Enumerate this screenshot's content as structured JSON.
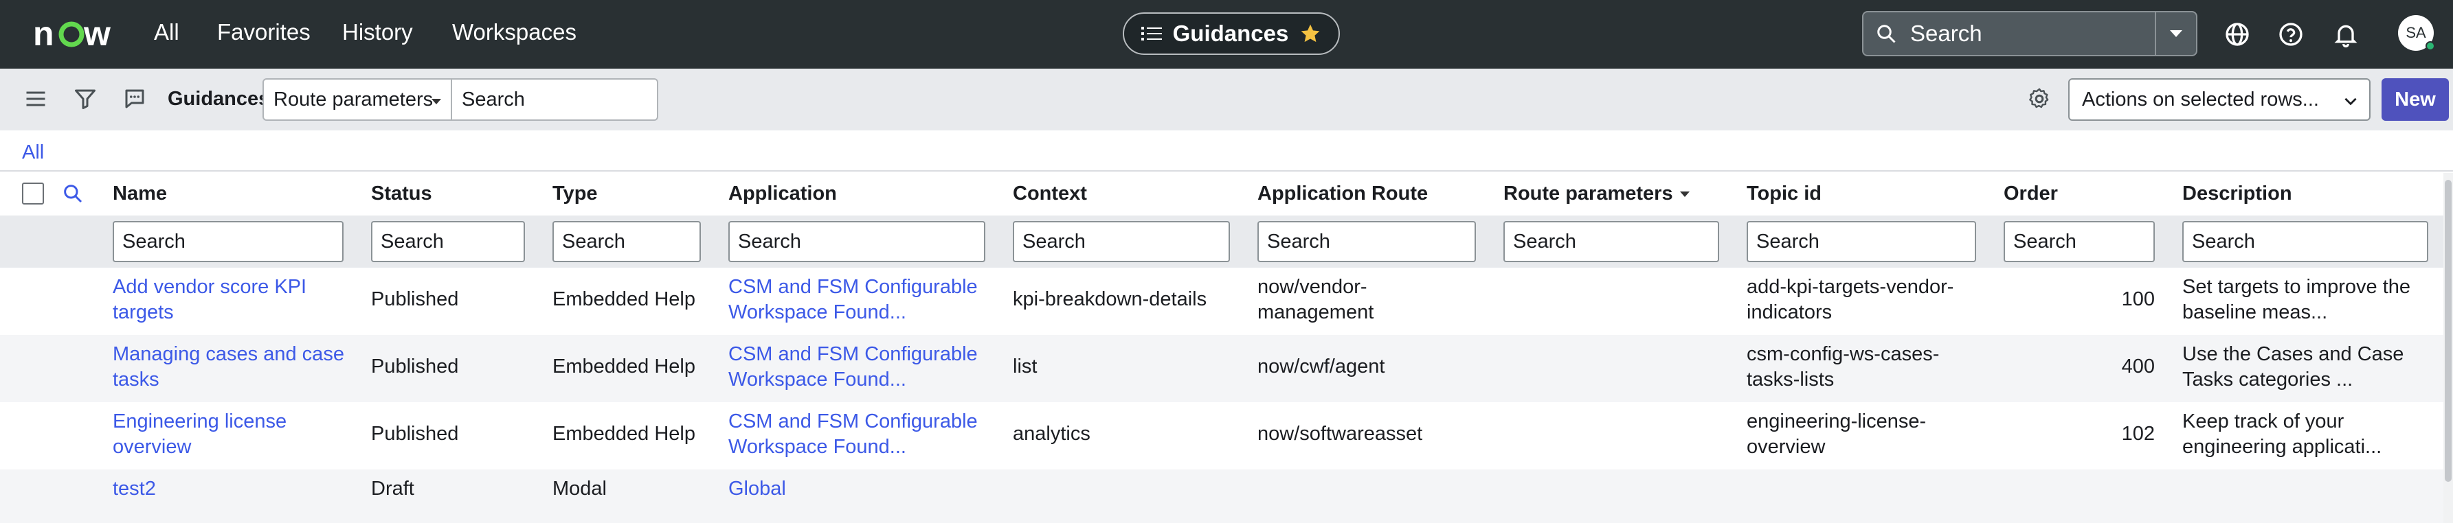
{
  "nav": {
    "logo": "now",
    "items": [
      "All",
      "Favorites",
      "History",
      "Workspaces"
    ],
    "center_title": "Guidances",
    "search_placeholder": "Search",
    "avatar_initials": "SA"
  },
  "toolbar": {
    "title": "Guidances",
    "route_select": "Route parameters",
    "search_placeholder": "Search",
    "actions_label": "Actions on selected rows...",
    "new_label": "New"
  },
  "breadcrumb": {
    "all": "All"
  },
  "table": {
    "columns": [
      "Name",
      "Status",
      "Type",
      "Application",
      "Context",
      "Application Route",
      "Route parameters",
      "Topic id",
      "Order",
      "Description"
    ],
    "filter_placeholder": "Search",
    "rows": [
      {
        "name": [
          "Add vendor score KPI",
          "targets"
        ],
        "status": "Published",
        "type": "Embedded Help",
        "application": [
          "CSM and FSM Configurable",
          "Workspace Found..."
        ],
        "context": "kpi-breakdown-details",
        "route": [
          "now/vendor-",
          "management"
        ],
        "route_params": "",
        "topic": [
          "add-kpi-targets-vendor-",
          "indicators"
        ],
        "order": "100",
        "description": [
          "Set targets to improve the",
          "baseline meas..."
        ]
      },
      {
        "name": [
          "Managing cases and case",
          "tasks"
        ],
        "status": "Published",
        "type": "Embedded Help",
        "application": [
          "CSM and FSM Configurable",
          "Workspace Found..."
        ],
        "context": "list",
        "route": [
          "now/cwf/agent",
          ""
        ],
        "route_params": "",
        "topic": [
          "csm-config-ws-cases-",
          "tasks-lists"
        ],
        "order": "400",
        "description": [
          "Use the Cases and Case",
          "Tasks categories ..."
        ]
      },
      {
        "name": [
          "Engineering license",
          "overview"
        ],
        "status": "Published",
        "type": "Embedded Help",
        "application": [
          "CSM and FSM Configurable",
          "Workspace Found..."
        ],
        "context": "analytics",
        "route": [
          "now/softwareasset",
          ""
        ],
        "route_params": "",
        "topic": [
          "engineering-license-",
          "overview"
        ],
        "order": "102",
        "description": [
          "Keep track of your",
          "engineering applicati..."
        ]
      },
      {
        "name": [
          "test2",
          ""
        ],
        "status": "Draft",
        "type": "Modal",
        "application": [
          "Global",
          ""
        ],
        "context": "",
        "route": [
          "",
          ""
        ],
        "route_params": "",
        "topic": [
          "",
          ""
        ],
        "order": "",
        "description": [
          "",
          ""
        ]
      }
    ]
  },
  "colors": {
    "nav_bg": "#293033",
    "toolbar_bg": "#e8eaed",
    "link": "#3c59e7",
    "primary_button": "#4f52bd",
    "row_alt": "#f4f5f7",
    "star": "#f5c242"
  }
}
